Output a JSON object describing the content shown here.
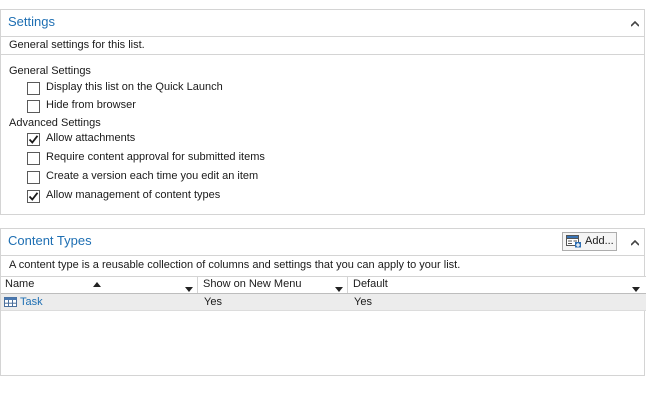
{
  "settings": {
    "title": "Settings",
    "description": "General settings for this list.",
    "general_heading": "General Settings",
    "general_items": [
      {
        "label": "Display this list on the Quick Launch",
        "checked": false
      },
      {
        "label": "Hide from browser",
        "checked": false
      }
    ],
    "advanced_heading": "Advanced Settings",
    "advanced_items": [
      {
        "label": "Allow attachments",
        "checked": true
      },
      {
        "label": "Require content approval for submitted items",
        "checked": false
      },
      {
        "label": "Create a version each time you edit an item",
        "checked": false
      },
      {
        "label": "Allow management of content types",
        "checked": true
      }
    ]
  },
  "content_types": {
    "title": "Content Types",
    "add_label": "Add...",
    "description": "A content type is a reusable collection of columns and settings that you can apply to your list.",
    "columns": [
      "Name",
      "Show on New Menu",
      "Default"
    ],
    "rows": [
      {
        "name": "Task",
        "show_on_new_menu": "Yes",
        "default": "Yes"
      }
    ]
  },
  "colors": {
    "accent": "#1e6fb3",
    "border": "#d4d4d4",
    "row_bg": "#ececec"
  },
  "icons": {
    "collapse": "chevron-up-icon",
    "add": "add-content-type-icon",
    "task": "content-type-table-icon",
    "column_menu": "dropdown-arrow-icon",
    "sort": "sort-ascending-icon"
  }
}
